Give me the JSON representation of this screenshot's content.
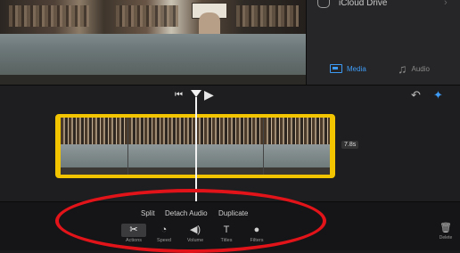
{
  "browser": {
    "icloud_label": "iCloud Drive",
    "chevron": "›",
    "media_tab": "Media",
    "audio_tab": "Audio"
  },
  "timeline": {
    "duration": "7.8s",
    "play_glyph": "▶",
    "skip_glyph": "⏮",
    "undo_glyph": "↶"
  },
  "toolbar": {
    "actions": [
      "Split",
      "Detach Audio",
      "Duplicate"
    ],
    "tools": [
      {
        "label": "Actions",
        "icon": "scissors-icon",
        "glyph": "✂",
        "selected": true
      },
      {
        "label": "Speed",
        "icon": "speedometer-icon",
        "glyph": "◔",
        "selected": false
      },
      {
        "label": "Volume",
        "icon": "speaker-icon",
        "glyph": "◀)",
        "selected": false
      },
      {
        "label": "Titles",
        "icon": "text-icon",
        "glyph": "T",
        "selected": false
      },
      {
        "label": "Filters",
        "icon": "filters-icon",
        "glyph": "●",
        "selected": false
      }
    ],
    "delete_label": "Delete",
    "delete_glyph": "🗑"
  },
  "colors": {
    "accent": "#3e9bf5",
    "clip_border": "#f3c400",
    "annotation": "#e2141a"
  }
}
